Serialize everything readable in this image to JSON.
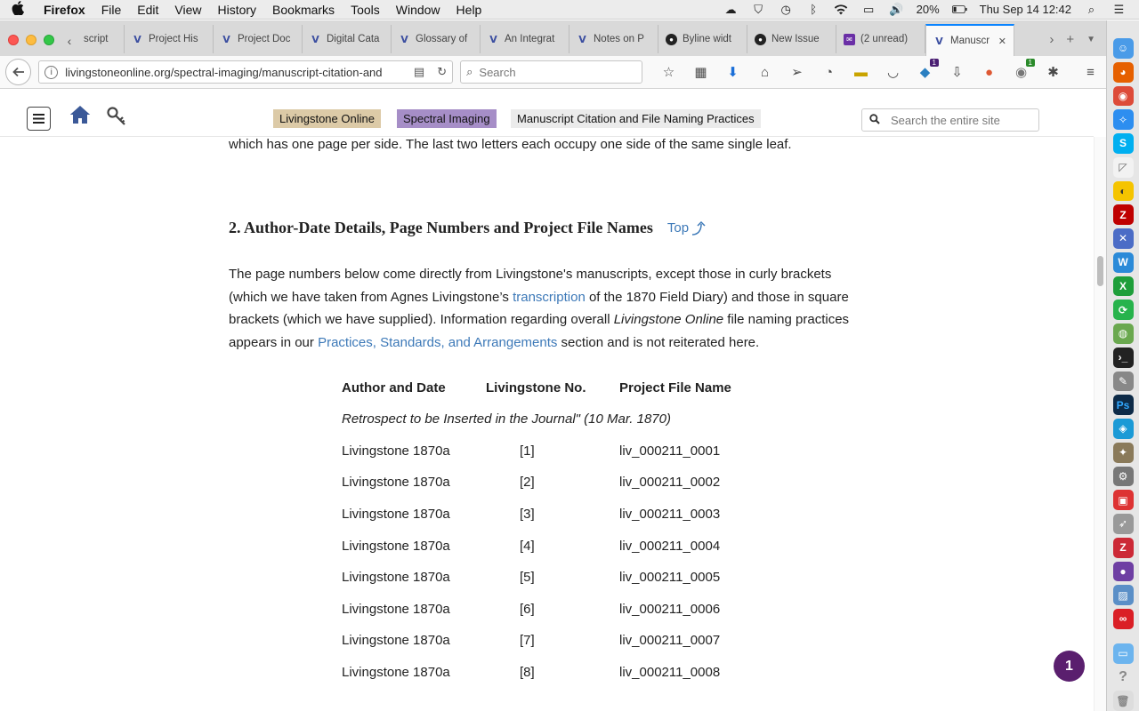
{
  "menubar": {
    "apple": "",
    "app": "Firefox",
    "items": [
      "File",
      "Edit",
      "View",
      "History",
      "Bookmarks",
      "Tools",
      "Window",
      "Help"
    ],
    "battery": "20%",
    "clock": "Thu Sep 14  12:42"
  },
  "tabs": [
    {
      "label": "script",
      "icon": "livingstone-favicon"
    },
    {
      "label": "Project His",
      "icon": "livingstone-favicon"
    },
    {
      "label": "Project Doc",
      "icon": "livingstone-favicon"
    },
    {
      "label": "Digital Cata",
      "icon": "livingstone-favicon"
    },
    {
      "label": "Glossary of",
      "icon": "livingstone-favicon"
    },
    {
      "label": "An Integrat",
      "icon": "livingstone-favicon"
    },
    {
      "label": "Notes on P",
      "icon": "livingstone-favicon"
    },
    {
      "label": "Byline widt",
      "icon": "github-favicon"
    },
    {
      "label": "New Issue",
      "icon": "github-favicon"
    },
    {
      "label": "(2 unread)",
      "icon": "mail-favicon"
    },
    {
      "label": "Manuscr",
      "icon": "livingstone-favicon",
      "active": true
    }
  ],
  "nav": {
    "url": "livingstoneonline.org/spectral-imaging/manuscript-citation-and",
    "search_placeholder": "Search",
    "badge_1": "1",
    "badge_2": "1"
  },
  "site": {
    "breadcrumbs": [
      "Livingstone Online",
      "Spectral Imaging",
      "Manuscript Citation and File Naming Practices"
    ],
    "search_placeholder": "Search the entire site",
    "colors": {
      "crumb1": "#dccaa7",
      "crumb2": "#a68ec7",
      "crumb3": "#ebebeb",
      "link": "#3d79b8"
    }
  },
  "content": {
    "intro_tail": "which has one page per side. The last two letters each occupy one side of the same single leaf.",
    "heading": "2. Author-Date Details, Page Numbers and Project File Names",
    "top_link": "Top",
    "para": {
      "p1": "The page numbers below come directly from Livingstone's manuscripts, except those in curly brackets (which we have taken from Agnes Livingstone’s ",
      "link1": "transcription",
      "p2": " of the 1870 Field Diary) and those in square brackets (which we have supplied). Information regarding overall ",
      "em1": "Livingstone Online",
      "p3": " file naming practices appears in our ",
      "link2": "Practices, Standards, and Arrangements",
      "p4": " section and is not reiterated here."
    },
    "table": {
      "headers": [
        "Author and Date",
        "Livingstone No.",
        "Project File Name"
      ],
      "caption": "Retrospect to be Inserted in the Journal\" (10 Mar. 1870)",
      "rows": [
        [
          "Livingstone 1870a",
          "[1]",
          "liv_000211_0001"
        ],
        [
          "Livingstone 1870a",
          "[2]",
          "liv_000211_0002"
        ],
        [
          "Livingstone 1870a",
          "[3]",
          "liv_000211_0003"
        ],
        [
          "Livingstone 1870a",
          "[4]",
          "liv_000211_0004"
        ],
        [
          "Livingstone 1870a",
          "[5]",
          "liv_000211_0005"
        ],
        [
          "Livingstone 1870a",
          "[6]",
          "liv_000211_0006"
        ],
        [
          "Livingstone 1870a",
          "[7]",
          "liv_000211_0007"
        ],
        [
          "Livingstone 1870a",
          "[8]",
          "liv_000211_0008"
        ]
      ]
    }
  },
  "notification_count": "1"
}
